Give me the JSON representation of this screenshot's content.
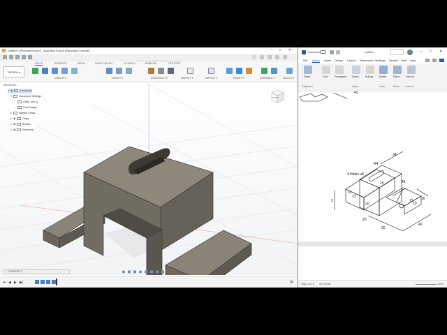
{
  "fusion": {
    "title": "Untitled* (Personal:Fusion) - Autodesk Fusion (Education License)",
    "doc_tab": "Untitled*",
    "window_controls": [
      "–",
      "□",
      "✕"
    ],
    "tabs": [
      "SOLID",
      "SURFACE",
      "MESH",
      "SHEET METAL",
      "PLASTIC",
      "MANAGE",
      "UTILITIES"
    ],
    "active_tab": "SOLID",
    "workspace": "DESIGN ▾",
    "groups": [
      "CREATE ▾",
      "MODIFY ▾",
      "CONSTRUCT ▾",
      "INSPECT ▾",
      "INSERT ▾",
      "ASSEMBLE ▾",
      "SELECT ▾"
    ],
    "browser": {
      "header": "BROWSER",
      "items": [
        {
          "label": "(Unsaved)",
          "level": 0,
          "chev": "▾",
          "selected": true
        },
        {
          "label": "Document Settings",
          "level": 1,
          "chev": "▾"
        },
        {
          "label": "Units: mm, g",
          "level": 2,
          "chev": ""
        },
        {
          "label": "Part Design",
          "level": 2,
          "chev": ""
        },
        {
          "label": "Named Views",
          "level": 1,
          "chev": "▸"
        },
        {
          "label": "Origin",
          "level": 1,
          "chev": "▸"
        },
        {
          "label": "Bodies",
          "level": 1,
          "chev": "▸"
        },
        {
          "label": "Sketches",
          "level": 1,
          "chev": "▸"
        }
      ]
    },
    "viewcube_label": "FRONT",
    "comments": "COMMENTS",
    "timeline_controls": [
      "⏮",
      "◀",
      "▶",
      "▶▏"
    ]
  },
  "word": {
    "autosave_label": "AutoSave",
    "doc_name": "Untitled",
    "window_controls": [
      "–",
      "□",
      "✕"
    ],
    "menu": [
      "File",
      "Home",
      "Insert",
      "Design",
      "Layout",
      "References",
      "Mailings",
      "Review",
      "View",
      "Help"
    ],
    "active_menu": "Home",
    "ribbon_buttons": [
      "Paste",
      "Font",
      "Paragraph",
      "Styles",
      "Editing",
      "Dictate",
      "Editor",
      "Add-ins"
    ],
    "ribbon_groups": [
      "Clipboard",
      "Styles",
      "Voice",
      "Editor",
      "Add-ins"
    ],
    "drawing": {
      "dims": [
        "4 Holes ⌀6",
        "R4",
        "34",
        "15",
        "R8",
        "10",
        "10",
        "20",
        "25",
        "40",
        "20",
        "3",
        "45"
      ]
    },
    "status": {
      "page": "Page 1 of 3",
      "words": "407 words",
      "zoom": "100%"
    }
  },
  "colors": {
    "model_face_top": "#8a8478",
    "model_face_front": "#706b61",
    "model_face_dark": "#5b5750",
    "word_blue": "#185abd",
    "fusion_blue": "#0a6bd6"
  }
}
